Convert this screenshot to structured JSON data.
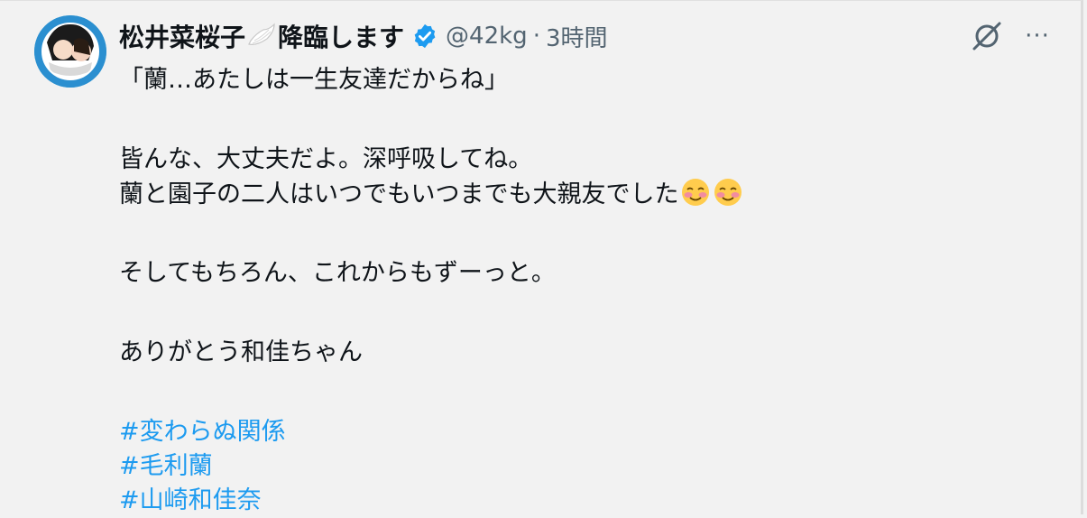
{
  "tweet": {
    "display_name": "松井菜桜子",
    "display_name_suffix": "降臨します",
    "handle": "@42kg",
    "separator": "·",
    "time": "3時間",
    "lines": [
      "「蘭…あたしは一生友達だからね」",
      "皆んな、大丈夫だよ。深呼吸してね。",
      "蘭と園子の二人はいつでもいつまでも大親友でした",
      "そしてもちろん、これからもずーっと。",
      "ありがとう和佳ちゃん"
    ],
    "hashtags": [
      "#変わらぬ関係",
      "#毛利蘭",
      "#山崎和佳奈"
    ]
  },
  "icons": {
    "wing": "wing-emoji",
    "verified": "verified-badge-icon",
    "grok": "grok-icon",
    "more": "more-icon",
    "smile": "smiling-face-emoji"
  },
  "colors": {
    "link": "#1d9bf0",
    "muted": "#536471",
    "verified": "#1d9bf0"
  },
  "more_glyph": "···"
}
